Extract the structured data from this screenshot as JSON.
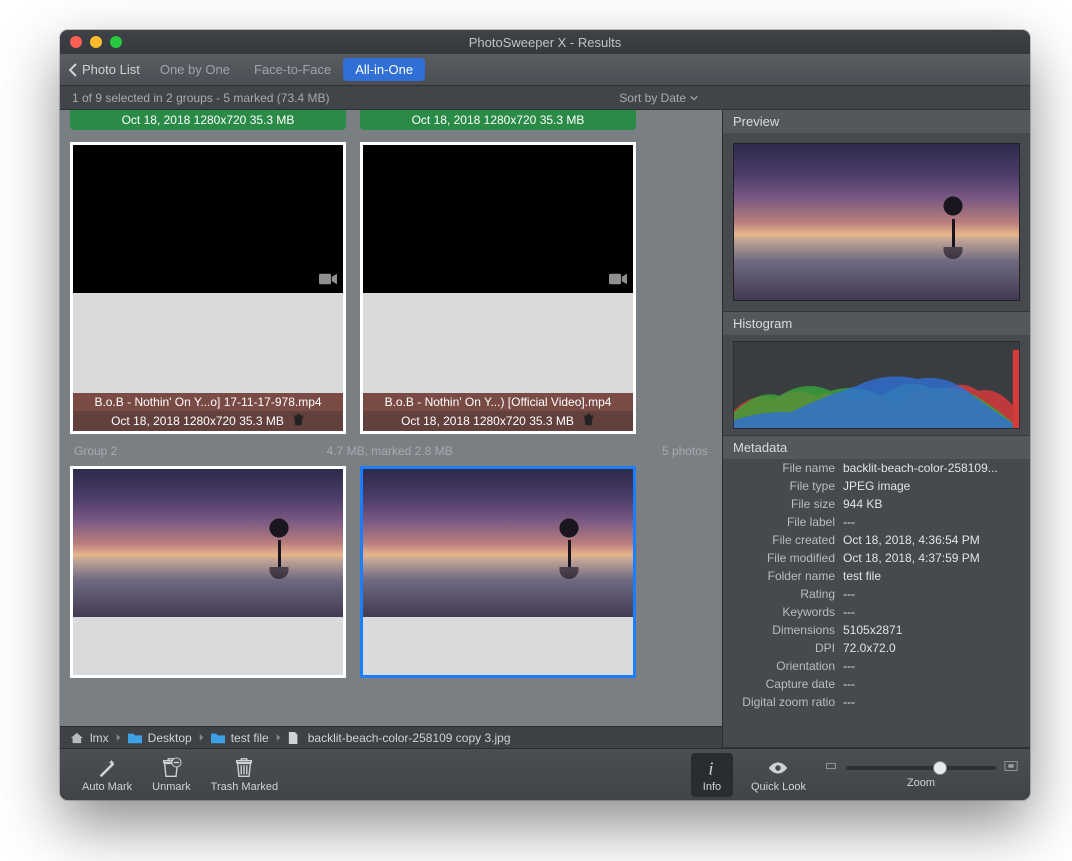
{
  "window": {
    "title": "PhotoSweeper X - Results"
  },
  "toolbar": {
    "back_label": "Photo List",
    "tabs": [
      "One by One",
      "Face-to-Face",
      "All-in-One"
    ],
    "active_tab": 2
  },
  "status": {
    "left": "1 of 9 selected in 2 groups - 5 marked (73.4 MB)",
    "sort_label": "Sort by Date"
  },
  "group1": {
    "top_bar_a": "Oct 18, 2018  1280x720  35.3 MB",
    "top_bar_b": "Oct 18, 2018  1280x720  35.3 MB",
    "title_a": "B.o.B - Nothin' On Y...o] 17-11-17-978.mp4",
    "meta_a": "Oct 18, 2018  1280x720  35.3 MB",
    "title_b": "B.o.B - Nothin' On Y...) [Official Video].mp4",
    "meta_b": "Oct 18, 2018  1280x720  35.3 MB"
  },
  "group2": {
    "header_left": "Group 2",
    "header_mid": "4.7 MB, marked 2.8 MB",
    "header_right": "5 photos"
  },
  "breadcrumb": {
    "items": [
      "lmx",
      "Desktop",
      "test file",
      "backlit-beach-color-258109 copy 3.jpg"
    ]
  },
  "right": {
    "preview_label": "Preview",
    "histogram_label": "Histogram",
    "metadata_label": "Metadata",
    "metadata": [
      [
        "File name",
        "backlit-beach-color-258109..."
      ],
      [
        "File type",
        "JPEG image"
      ],
      [
        "File size",
        "944 KB"
      ],
      [
        "File label",
        "---"
      ],
      [
        "File created",
        "Oct 18, 2018, 4:36:54 PM"
      ],
      [
        "File modified",
        "Oct 18, 2018, 4:37:59 PM"
      ],
      [
        "Folder name",
        "test file"
      ],
      [
        "Rating",
        "---"
      ],
      [
        "Keywords",
        "---"
      ],
      [
        "Dimensions",
        "5105x2871"
      ],
      [
        "DPI",
        "72.0x72.0"
      ],
      [
        "Orientation",
        "---"
      ],
      [
        "Capture date",
        "---"
      ],
      [
        "Digital zoom ratio",
        "---"
      ]
    ]
  },
  "bottom": {
    "auto_mark": "Auto Mark",
    "unmark": "Unmark",
    "trash_marked": "Trash Marked",
    "info": "Info",
    "quick_look": "Quick Look",
    "zoom": "Zoom"
  }
}
